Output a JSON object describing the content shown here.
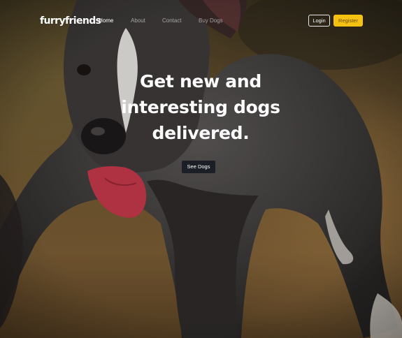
{
  "brand": {
    "logo_text": "furryfriends"
  },
  "nav": {
    "links": [
      {
        "label": "Home",
        "active": true
      },
      {
        "label": "About",
        "active": false
      },
      {
        "label": "Contact",
        "active": false
      },
      {
        "label": "Buy Dogs",
        "active": false
      }
    ],
    "login_label": "Login",
    "register_label": "Register"
  },
  "hero": {
    "headline_lines": [
      "Get new and",
      "interesting dogs",
      "delivered."
    ],
    "cta_label": "See Dogs",
    "background_image": "photo-of-dark-brown-pit-bull-dog-on-muddy-ground"
  },
  "colors": {
    "accent": "#f5c211",
    "cta_bg": "#1c1f26",
    "text": "#ffffff"
  }
}
